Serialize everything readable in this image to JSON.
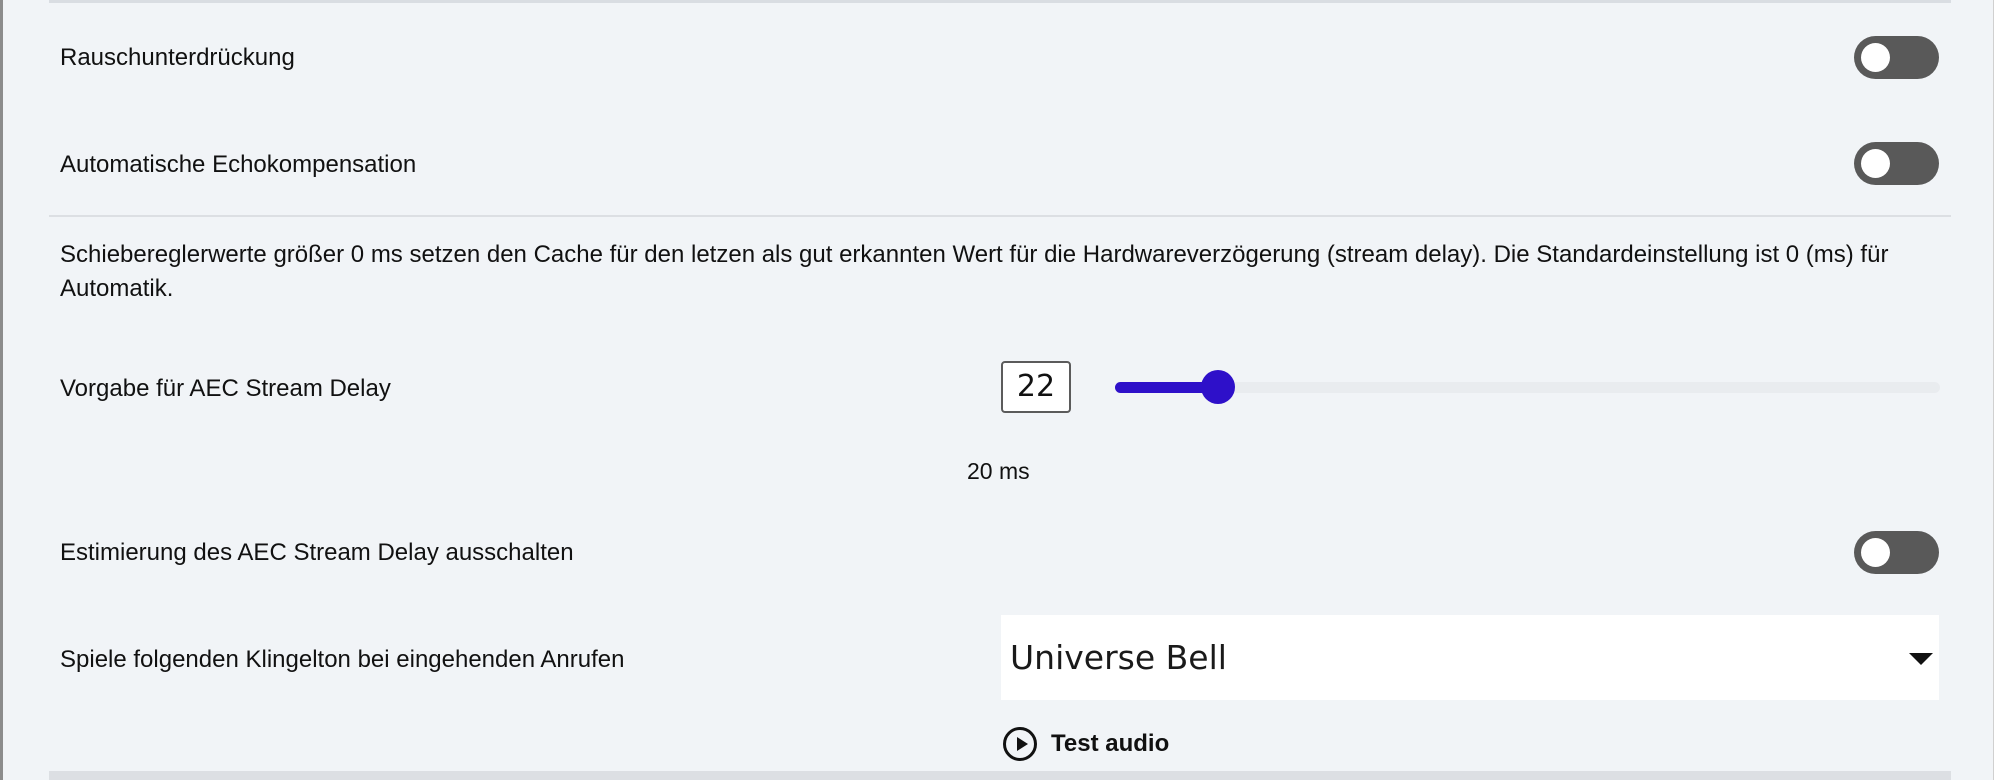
{
  "settings": {
    "noise_suppression": {
      "label": "Rauschunterdrückung",
      "enabled": false
    },
    "echo_cancellation": {
      "label": "Automatische Echokompensation",
      "enabled": false
    },
    "stream_delay_note": "Schiebereglerwerte größer 0 ms setzen den Cache für den letzen als gut erkannten Wert für die Hardwareverzögerung (stream delay). Die Standardeinstellung ist 0 (ms) für Automatik.",
    "aec_stream_delay": {
      "label": "Vorgabe für AEC Stream Delay",
      "value": "22",
      "slider_caption": "20 ms",
      "slider_value": 22,
      "slider_fraction": 0.125
    },
    "disable_delay_estimation": {
      "label": "Estimierung des AEC Stream Delay ausschalten",
      "enabled": false
    },
    "ringtone": {
      "label": "Spiele folgenden Klingelton bei eingehenden Anrufen",
      "selected": "Universe Bell",
      "test_label": "Test audio"
    }
  },
  "colors": {
    "accent": "#2e10c9",
    "toggle_off": "#595959",
    "background": "#f1f4f7"
  },
  "icons": {
    "dropdown": "caret-down-icon",
    "test": "play-circle-icon"
  }
}
